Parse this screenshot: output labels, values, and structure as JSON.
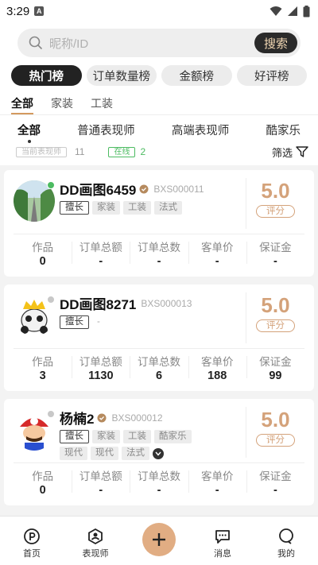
{
  "status": {
    "time": "3:29",
    "notif_letter": "A"
  },
  "search": {
    "placeholder": "昵称/ID",
    "button": "搜索"
  },
  "rank_tabs": [
    "热门榜",
    "订单数量榜",
    "金额榜",
    "好评榜"
  ],
  "categories": [
    "全部",
    "家装",
    "工装"
  ],
  "sub_tabs": [
    "全部",
    "普通表现师",
    "高端表现师",
    "酷家乐"
  ],
  "filter": {
    "current_label": "当前表现师",
    "current_count": "11",
    "online_label": "在线",
    "online_count": "2",
    "filter_label": "筛选"
  },
  "cards": [
    {
      "name": "DD画图6459",
      "code": "BXS000011",
      "online": true,
      "tags": [
        "擅长",
        "家装",
        "工装",
        "法式"
      ],
      "score": "5.0",
      "score_label": "评分",
      "stats": [
        {
          "k": "作品",
          "v": "0"
        },
        {
          "k": "订单总额",
          "v": "-"
        },
        {
          "k": "订单总数",
          "v": "-"
        },
        {
          "k": "客单价",
          "v": "-"
        },
        {
          "k": "保证金",
          "v": "-"
        }
      ]
    },
    {
      "name": "DD画图8271",
      "code": "BXS000013",
      "online": false,
      "tags": [
        "擅长",
        "-"
      ],
      "score": "5.0",
      "score_label": "评分",
      "stats": [
        {
          "k": "作品",
          "v": "3"
        },
        {
          "k": "订单总额",
          "v": "1130"
        },
        {
          "k": "订单总数",
          "v": "6"
        },
        {
          "k": "客单价",
          "v": "188"
        },
        {
          "k": "保证金",
          "v": "99"
        }
      ]
    },
    {
      "name": "杨楠2",
      "code": "BXS000012",
      "online": false,
      "tags": [
        "擅长",
        "家装",
        "工装",
        "酷家乐",
        "现代",
        "现代",
        "法式"
      ],
      "score": "5.0",
      "score_label": "评分",
      "stats": [
        {
          "k": "作品",
          "v": "0"
        },
        {
          "k": "订单总额",
          "v": "-"
        },
        {
          "k": "订单总数",
          "v": "-"
        },
        {
          "k": "客单价",
          "v": "-"
        },
        {
          "k": "保证金",
          "v": "-"
        }
      ]
    }
  ],
  "tabbar": [
    "首页",
    "表现师",
    "消息",
    "我的"
  ],
  "colors": {
    "accent": "#d4a27a",
    "dark": "#222222",
    "online": "#4cbb61"
  }
}
